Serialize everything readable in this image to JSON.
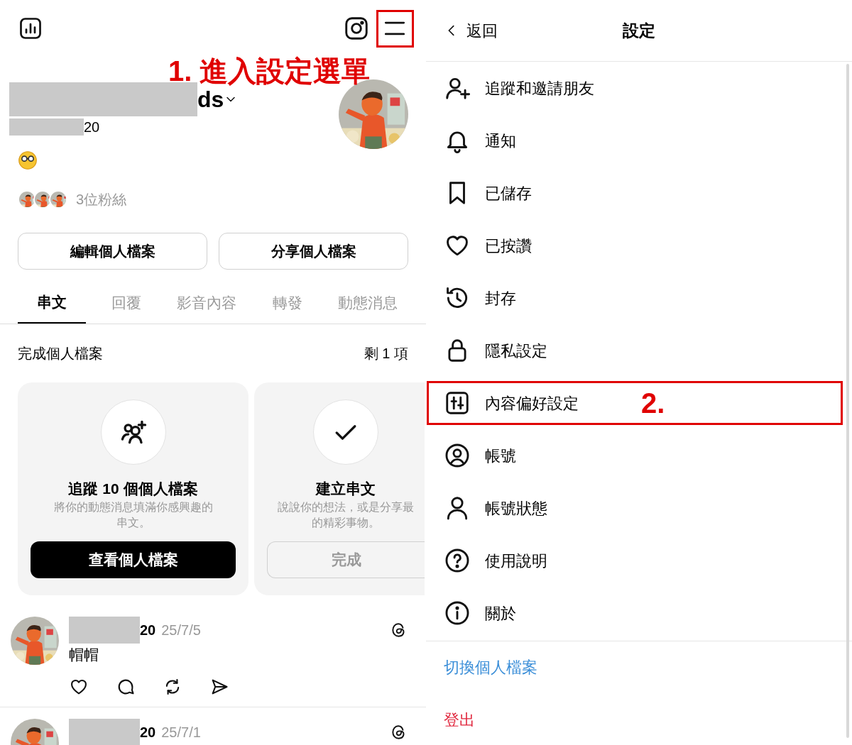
{
  "profile_screen": {
    "name_visible": "ds",
    "handle_visible": "20",
    "followers": "3位粉絲",
    "buttons": [
      "編輯個人檔案",
      "分享個人檔案"
    ],
    "tabs": [
      {
        "label": "串文",
        "selected": true
      },
      {
        "label": "回覆",
        "selected": false
      },
      {
        "label": "影音內容",
        "selected": false
      },
      {
        "label": "轉發",
        "selected": false
      },
      {
        "label": "動態消息",
        "selected": false
      }
    ],
    "completion": {
      "title": "完成個人檔案",
      "remaining": "剩 1 項"
    },
    "cards": [
      {
        "kind": "follow",
        "title": "追蹤 10 個個人檔案",
        "description_lines": [
          "將你的動態消息填滿你感興趣的",
          "串文。"
        ],
        "button": "查看個人檔案",
        "done": false
      },
      {
        "kind": "post",
        "title": "建立串文",
        "description_lines": [
          "說說你的想法，或是分享最",
          "的精彩事物。"
        ],
        "button": "完成",
        "done": true
      }
    ],
    "posts": [
      {
        "name_visible": "20",
        "date": "25/7/5",
        "text": "帽帽"
      },
      {
        "name_visible": "20",
        "date": "25/7/1"
      }
    ]
  },
  "settings_screen": {
    "back": "返回",
    "title": "設定",
    "items": [
      {
        "kind": "add-person",
        "label": "追蹤和邀請朋友"
      },
      {
        "kind": "bell",
        "label": "通知"
      },
      {
        "kind": "bookmark",
        "label": "已儲存"
      },
      {
        "kind": "heart",
        "label": "已按讚"
      },
      {
        "kind": "history",
        "label": "封存"
      },
      {
        "kind": "lock",
        "label": "隱私設定"
      },
      {
        "kind": "sliders",
        "label": "內容偏好設定"
      },
      {
        "kind": "account",
        "label": "帳號"
      },
      {
        "kind": "person",
        "label": "帳號狀態"
      },
      {
        "kind": "help",
        "label": "使用說明"
      },
      {
        "kind": "info",
        "label": "關於"
      }
    ],
    "links": [
      {
        "kind": "switch",
        "label": "切換個人檔案"
      },
      {
        "kind": "logout",
        "label": "登出"
      }
    ]
  },
  "annotations": [
    {
      "kind": "menu-marker",
      "text": "1. 進入設定選單"
    },
    {
      "kind": "item-marker",
      "text": "2."
    }
  ]
}
